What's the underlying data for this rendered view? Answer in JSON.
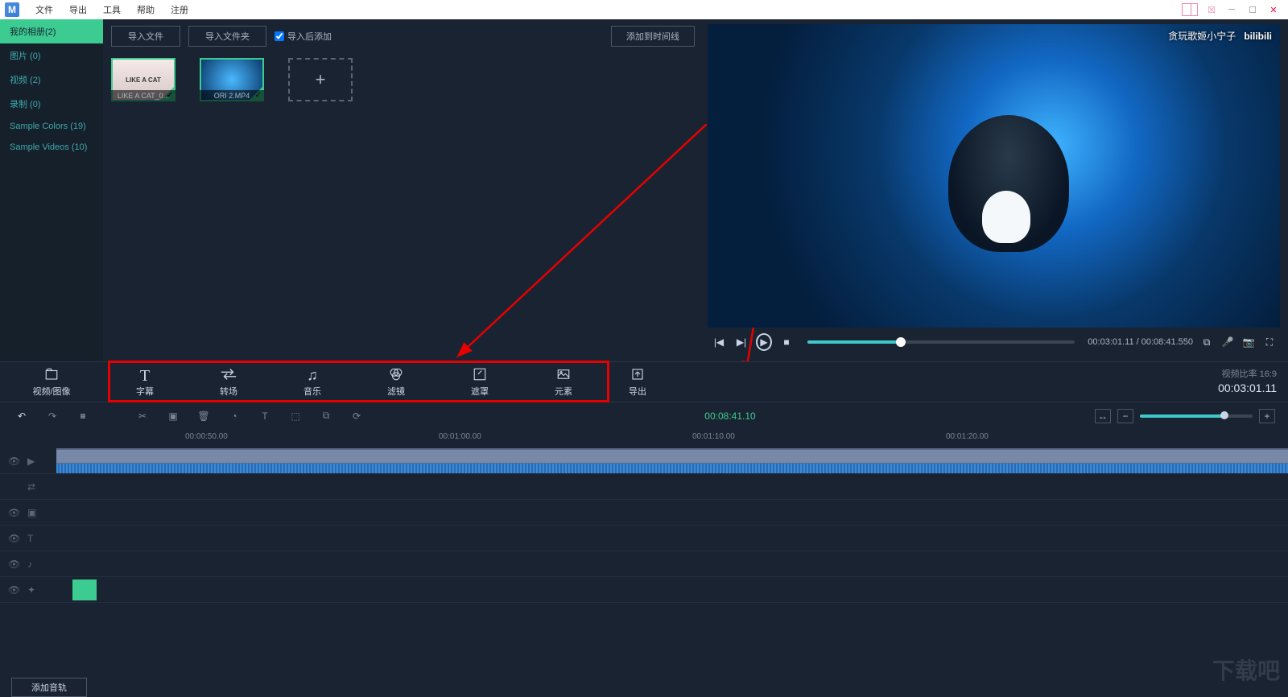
{
  "menu": {
    "file": "文件",
    "export": "导出",
    "tools": "工具",
    "help": "帮助",
    "register": "注册"
  },
  "sidebar": {
    "items": [
      {
        "label": "我的相册(2)",
        "active": true
      },
      {
        "label": "图片 (0)"
      },
      {
        "label": "视频 (2)"
      },
      {
        "label": "录制 (0)"
      },
      {
        "label": "Sample Colors (19)"
      },
      {
        "label": "Sample Videos (10)"
      }
    ]
  },
  "library": {
    "import_file": "导入文件",
    "import_folder": "导入文件夹",
    "add_after_import": "导入后添加",
    "add_to_timeline": "添加到时间线",
    "thumbs": [
      {
        "name": "LIKE A CAT_0...",
        "overlay": "LIKE A CAT"
      },
      {
        "name": "ORI 2.MP4"
      }
    ]
  },
  "preview": {
    "watermark1": "贪玩歌姬小宁子",
    "watermark2": "bilibili",
    "time_current": "00:03:01.11",
    "time_total": "00:08:41.550"
  },
  "tabs": {
    "items": [
      {
        "label": "视频/图像",
        "icon": "folder"
      },
      {
        "label": "字幕",
        "icon": "text"
      },
      {
        "label": "转场",
        "icon": "transition"
      },
      {
        "label": "音乐",
        "icon": "music"
      },
      {
        "label": "滤镜",
        "icon": "filter"
      },
      {
        "label": "遮罩",
        "icon": "mask"
      },
      {
        "label": "元素",
        "icon": "element"
      },
      {
        "label": "导出",
        "icon": "export"
      }
    ],
    "aspect_label": "视频比率 16:9",
    "duration": "00:03:01.11"
  },
  "timeline": {
    "playhead": "00:08:41.10",
    "marks": [
      "00:00:50.00",
      "00:01:00.00",
      "00:01:10.00",
      "00:01:20.00"
    ],
    "add_audio_track": "添加音轨"
  },
  "watermark_page": "下载吧"
}
